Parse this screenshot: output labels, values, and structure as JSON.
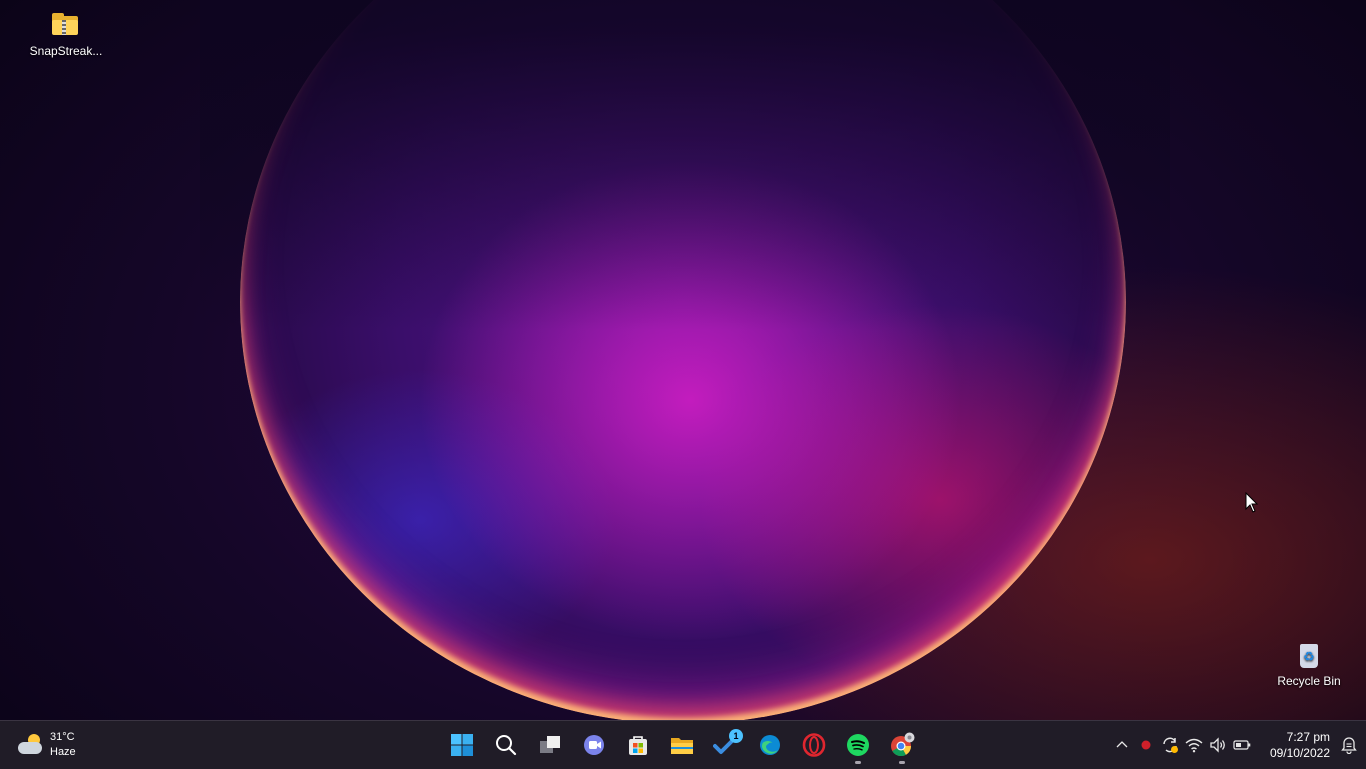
{
  "desktop": {
    "icons": [
      {
        "label": "SnapStreak...",
        "icon": "zipped-folder-icon"
      },
      {
        "label": "Recycle Bin",
        "icon": "recycle-bin-icon"
      }
    ]
  },
  "taskbar": {
    "weather": {
      "temperature": "31°C",
      "condition": "Haze",
      "icon": "partly-cloudy-icon"
    },
    "apps": [
      {
        "name": "Start",
        "icon": "windows-start-icon"
      },
      {
        "name": "Search",
        "icon": "search-icon"
      },
      {
        "name": "Task View",
        "icon": "task-view-icon"
      },
      {
        "name": "Chat",
        "icon": "teams-chat-icon"
      },
      {
        "name": "Microsoft Store",
        "icon": "store-icon"
      },
      {
        "name": "File Explorer",
        "icon": "file-explorer-icon"
      },
      {
        "name": "To Do",
        "icon": "todo-icon",
        "badge": "1"
      },
      {
        "name": "Microsoft Edge",
        "icon": "edge-icon"
      },
      {
        "name": "Opera",
        "icon": "opera-icon"
      },
      {
        "name": "Spotify",
        "icon": "spotify-icon",
        "running": true
      },
      {
        "name": "Google Chrome",
        "icon": "chrome-icon",
        "running": true
      }
    ],
    "tray": {
      "icons": [
        "chevron-up-icon",
        "recording-dot-icon",
        "sync-icon",
        "wifi-icon",
        "volume-icon",
        "battery-icon"
      ],
      "time": "7:27 pm",
      "date": "09/10/2022",
      "notification_icon": "notification-icon"
    }
  },
  "colors": {
    "taskbar": "#201c27",
    "accent": "#4cc2ff"
  }
}
